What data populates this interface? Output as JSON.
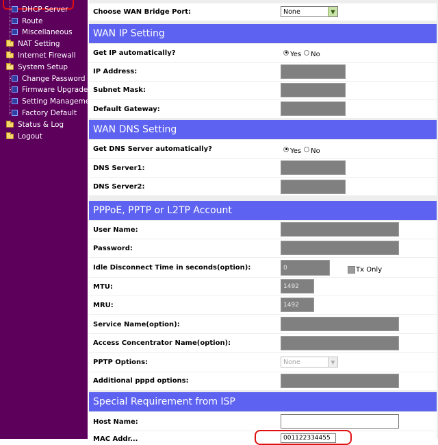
{
  "sidebar": {
    "items": [
      {
        "label": "DHCP Server",
        "icon": "page-icon"
      },
      {
        "label": "Route",
        "icon": "page-icon"
      },
      {
        "label": "Miscellaneous",
        "icon": "page-icon"
      },
      {
        "label": "NAT Setting",
        "icon": "folder-icon"
      },
      {
        "label": "Internet Firewall",
        "icon": "folder-icon"
      },
      {
        "label": "System Setup",
        "icon": "folder-open-icon"
      },
      {
        "label": "Change Password",
        "icon": "page-icon"
      },
      {
        "label": "Firmware Upgrade",
        "icon": "page-icon"
      },
      {
        "label": "Setting Management",
        "icon": "page-icon"
      },
      {
        "label": "Factory Default",
        "icon": "page-icon"
      },
      {
        "label": "Status & Log",
        "icon": "folder-icon"
      },
      {
        "label": "Logout",
        "icon": "folder-icon"
      }
    ]
  },
  "wan_bridge": {
    "label": "Choose WAN Bridge Port:",
    "value": "None"
  },
  "wan_ip": {
    "title": "WAN IP Setting",
    "auto_label": "Get IP automatically?",
    "yes": "Yes",
    "no": "No",
    "ip_label": "IP Address:",
    "mask_label": "Subnet Mask:",
    "gateway_label": "Default Gateway:"
  },
  "wan_dns": {
    "title": "WAN DNS Setting",
    "auto_label": "Get DNS Server automatically?",
    "yes": "Yes",
    "no": "No",
    "dns1_label": "DNS Server1:",
    "dns2_label": "DNS Server2:"
  },
  "pppoe": {
    "title": "PPPoE, PPTP or L2TP Account",
    "user_label": "User Name:",
    "password_label": "Password:",
    "idle_label": "Idle Disconnect Time in seconds(option):",
    "idle_value": "0",
    "tx_only": "Tx Only",
    "mtu_label": "MTU:",
    "mtu_value": "1492",
    "mru_label": "MRU:",
    "mru_value": "1492",
    "service_label": "Service Name(option):",
    "ac_label": "Access Concentrator Name(option):",
    "pptp_label": "PPTP Options:",
    "pptp_value": "None",
    "pppd_label": "Additional pppd options:"
  },
  "isp": {
    "title": "Special Requirement from ISP",
    "host_label": "Host Name:",
    "mac_label": "MAC Addr...",
    "mac_value": "001122334455"
  },
  "colors": {
    "sidebar": "#5c005c",
    "section": "#5d62f0",
    "highlight": "#e01010"
  }
}
